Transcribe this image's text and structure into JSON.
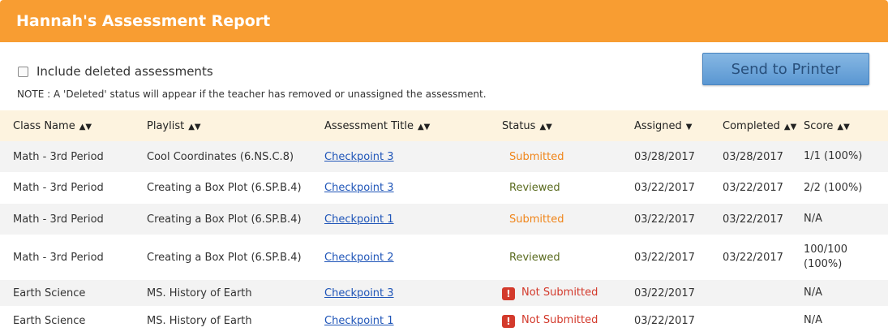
{
  "header": {
    "title": "Hannah's Assessment Report"
  },
  "controls": {
    "checkbox_label": "Include deleted assessments",
    "checkbox_checked": false,
    "note": "NOTE : A 'Deleted' status will appear if the teacher has removed or unassigned the assessment.",
    "print_button": "Send to Printer"
  },
  "table": {
    "columns": [
      {
        "label": "Class Name",
        "sort": "both"
      },
      {
        "label": "Playlist",
        "sort": "both"
      },
      {
        "label": "Assessment Title",
        "sort": "both"
      },
      {
        "label": "Status",
        "sort": "both"
      },
      {
        "label": "Assigned",
        "sort": "desc"
      },
      {
        "label": "Completed",
        "sort": "both"
      },
      {
        "label": "Score",
        "sort": "both"
      }
    ],
    "rows": [
      {
        "class_name": "Math - 3rd Period",
        "playlist": "Cool Coordinates (6.NS.C.8)",
        "title": "Checkpoint 3",
        "status": "Submitted",
        "assigned": "03/28/2017",
        "completed": "03/28/2017",
        "score": "1/1 (100%)"
      },
      {
        "class_name": "Math - 3rd Period",
        "playlist": "Creating a Box Plot (6.SP.B.4)",
        "title": "Checkpoint 3",
        "status": "Reviewed",
        "assigned": "03/22/2017",
        "completed": "03/22/2017",
        "score": "2/2 (100%)"
      },
      {
        "class_name": "Math - 3rd Period",
        "playlist": "Creating a Box Plot (6.SP.B.4)",
        "title": "Checkpoint 1",
        "status": "Submitted",
        "assigned": "03/22/2017",
        "completed": "03/22/2017",
        "score": "N/A"
      },
      {
        "class_name": "Math - 3rd Period",
        "playlist": "Creating a Box Plot (6.SP.B.4)",
        "title": "Checkpoint 2",
        "status": "Reviewed",
        "assigned": "03/22/2017",
        "completed": "03/22/2017",
        "score": "100/100 (100%)"
      },
      {
        "class_name": "Earth Science",
        "playlist": "MS. History of Earth",
        "title": "Checkpoint 3",
        "status": "Not Submitted",
        "assigned": "03/22/2017",
        "completed": "",
        "score": "N/A"
      },
      {
        "class_name": "Earth Science",
        "playlist": "MS. History of Earth",
        "title": "Checkpoint 1",
        "status": "Not Submitted",
        "assigned": "03/22/2017",
        "completed": "",
        "score": "N/A"
      }
    ]
  },
  "colors": {
    "header_bg": "#f89d32",
    "header_row_bg": "#fdf3df",
    "submitted": "#f0851a",
    "reviewed": "#5a6b1f",
    "not_submitted": "#d33a2c",
    "link": "#1f55b8"
  },
  "icons": {
    "sort_both": "sort-both-icon",
    "sort_desc": "sort-desc-icon",
    "warning": "exclamation-icon"
  }
}
